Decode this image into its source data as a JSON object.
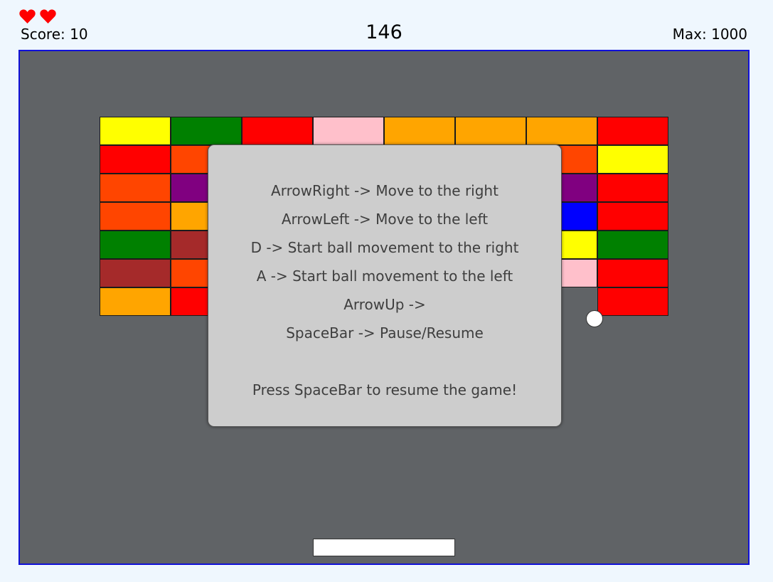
{
  "hud": {
    "lives": 2,
    "heart_icon": "heart-icon",
    "heart_color": "#ff0000",
    "score_text": "Score: 10",
    "timer": "146",
    "max_text": "Max: 1000"
  },
  "colors": {
    "board_background": "#606366",
    "board_border": "#1010d8",
    "page_background": "#eff7fe",
    "overlay_background": "#cdcdcd"
  },
  "bricks": {
    "rows": [
      [
        "#ffff00",
        "#008000",
        "#ff0000",
        "#ffc0cb",
        "#ffa500",
        "#ffa500",
        "#ffa500",
        "#ff0000"
      ],
      [
        "#ff0000",
        "#ff4500",
        "#ff4500",
        "#ff4500",
        "#ff4500",
        "#ff4500",
        "#ff4500",
        "#ffff00"
      ],
      [
        "#ff4500",
        "#800080",
        "#800080",
        "#800080",
        "#800080",
        "#800080",
        "#800080",
        "#ff0000"
      ],
      [
        "#ff4500",
        "#ffa500",
        "#ffa500",
        "#ffa500",
        "#ffa500",
        "#ffa500",
        "#0000ff",
        "#ff0000"
      ],
      [
        "#008000",
        "#a52a2a",
        "#a52a2a",
        "#a52a2a",
        "#a52a2a",
        "#a52a2a",
        "#ffff00",
        "#008000"
      ],
      [
        "#a52a2a",
        "#ff4500",
        "#ff4500",
        "#ff4500",
        "#ff4500",
        "#ff4500",
        "#ffc0cb",
        "#ff0000"
      ],
      [
        "#ffa500",
        "#ff0000",
        null,
        null,
        null,
        null,
        null,
        "#ff0000"
      ]
    ]
  },
  "pause_menu": {
    "lines": [
      "ArrowRight -> Move to the right",
      "ArrowLeft -> Move to the left",
      "D -> Start ball movement to the right",
      "A -> Start ball movement to the left",
      "ArrowUp ->",
      "SpaceBar -> Pause/Resume",
      "",
      "Press SpaceBar to resume the game!"
    ]
  }
}
